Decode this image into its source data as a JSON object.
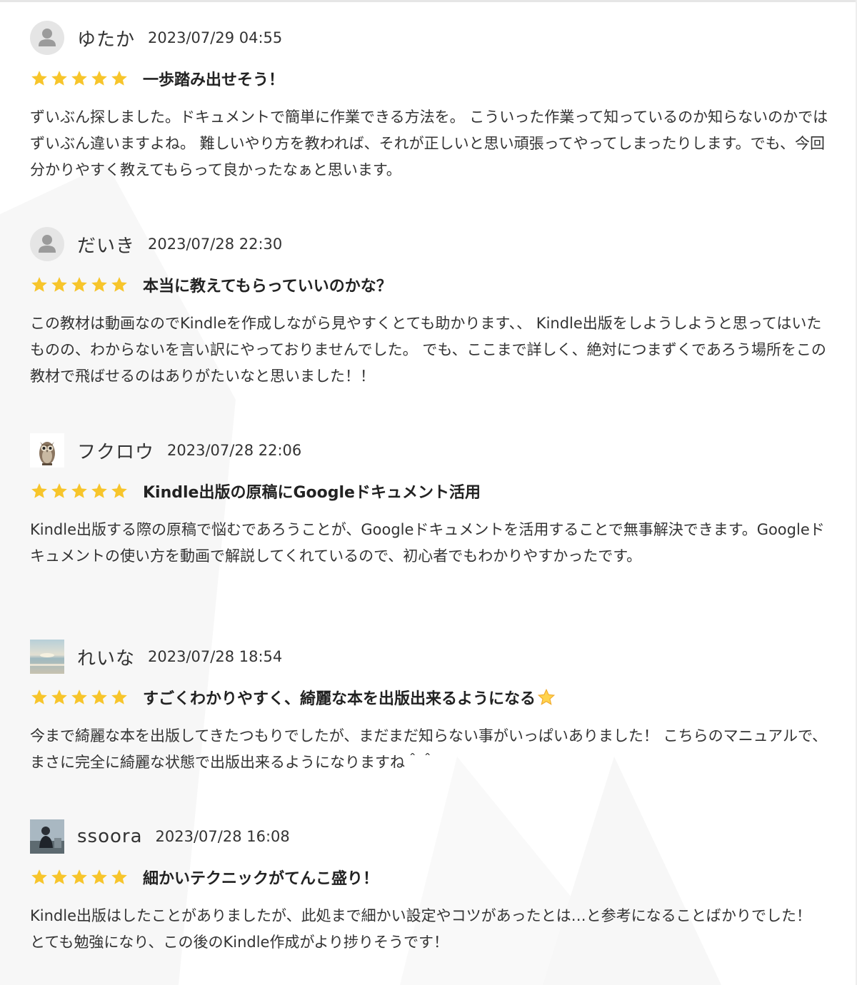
{
  "colors": {
    "star": "#f7c52b",
    "text": "#333333",
    "avatar_bg": "#e5e5e5",
    "avatar_icon": "#9b9b9b"
  },
  "reviews": [
    {
      "name": "ゆたか",
      "date": "2023/07/29 04:55",
      "avatar": "default-user-icon",
      "rating": 5,
      "title": "一歩踏み出せそう！",
      "body": "ずいぶん探しました。ドキュメントで簡単に作業できる方法を。 こういった作業って知っているのか知らないのかではずいぶん違いますよね。 難しいやり方を教われば、それが正しいと思い頑張ってやってしまったりします。でも、今回分かりやすく教えてもらって良かったなぁと思います。"
    },
    {
      "name": "だいき",
      "date": "2023/07/28 22:30",
      "avatar": "default-user-icon",
      "rating": 5,
      "title": "本当に教えてもらっていいのかな？",
      "body": "この教材は動画なのでKindleを作成しながら見やすくとても助かります、、 Kindle出版をしようしようと思ってはいたものの、わからないを言い訳にやっておりませんでした。 でも、ここまで詳しく、絶対につまずくであろう場所をこの教材で飛ばせるのはありがたいなと思いました！！"
    },
    {
      "name": "フクロウ",
      "date": "2023/07/28 22:06",
      "avatar": "owl-avatar",
      "rating": 5,
      "title": "Kindle出版の原稿にGoogleドキュメント活用",
      "body": "Kindle出版する際の原稿で悩むであろうことが、Googleドキュメントを活用することで無事解決できます。Googleドキュメントの使い方を動画で解説してくれているので、初心者でもわかりやすかったです。"
    },
    {
      "name": "れいな",
      "date": "2023/07/28 18:54",
      "avatar": "beach-photo-avatar",
      "rating": 5,
      "title": "すごくわかりやすく、綺麗な本を出版出来るようになる",
      "title_emoji": "star-emoji",
      "body": "今まで綺麗な本を出版してきたつもりでしたが、まだまだ知らない事がいっぱいありました！ こちらのマニュアルで、まさに完全に綺麗な状態で出版出来るようになりますね＾＾"
    },
    {
      "name": "ssoora",
      "date": "2023/07/28 16:08",
      "avatar": "person-photo-avatar",
      "rating": 5,
      "title": "細かいテクニックがてんこ盛り！",
      "body": "Kindle出版はしたことがありましたが、此処まで細かい設定やコツがあったとは…と参考になることばかりでした！ とても勉強になり、この後のKindle作成がより捗りそうです！"
    }
  ]
}
